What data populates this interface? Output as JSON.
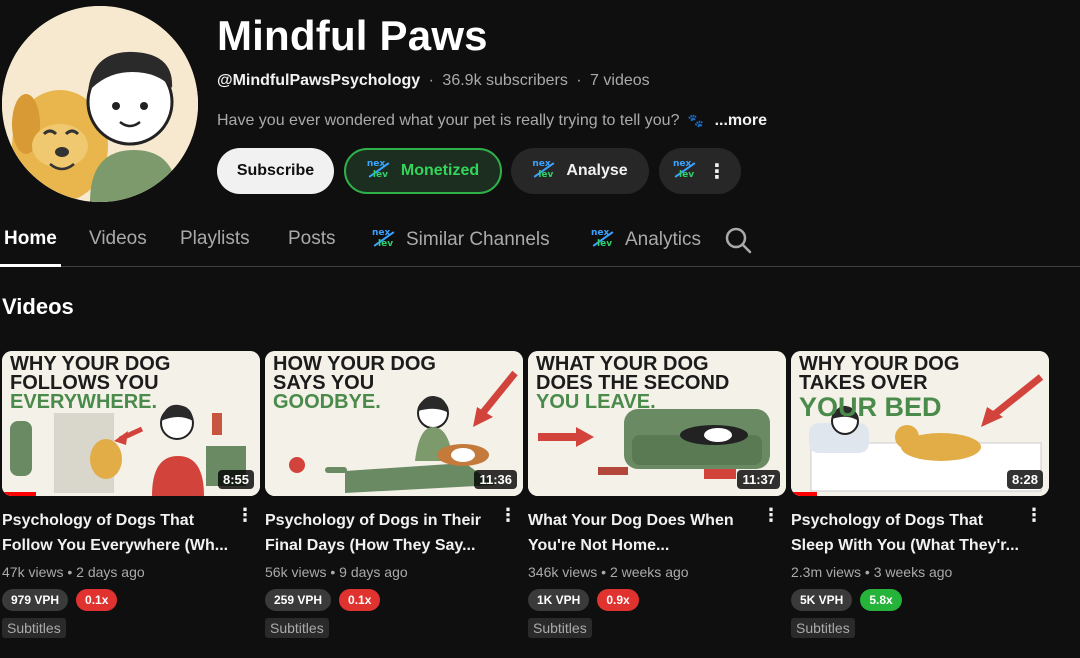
{
  "channel": {
    "name": "Mindful Paws",
    "handle": "@MindfulPawsPsychology",
    "subscribers": "36.9k subscribers",
    "video_count": "7 videos",
    "description": "Have you ever wondered what your pet is really trying to tell you?",
    "more_label": "...more",
    "separator": "·"
  },
  "buttons": {
    "subscribe": "Subscribe",
    "monetized": "Monetized",
    "analyse": "Analyse",
    "more_icon": "⋮"
  },
  "tabs": {
    "home": "Home",
    "videos": "Videos",
    "playlists": "Playlists",
    "posts": "Posts",
    "similar_channels": "Similar Channels",
    "analytics": "Analytics"
  },
  "section_title": "Videos",
  "videos": [
    {
      "thumb_lines": [
        "WHY YOUR DOG",
        "FOLLOWS YOU",
        "EVERYWHERE."
      ],
      "duration": "8:55",
      "title": "Psychology of Dogs That Follow You Everywhere (Wh...",
      "views": "47k views",
      "age": "2 days ago",
      "vph": "979 VPH",
      "ratio": "0.1x",
      "ratio_color": "red",
      "subtitles": "Subtitles",
      "progress": 0.13
    },
    {
      "thumb_lines": [
        "HOW YOUR DOG",
        "SAYS YOU",
        "GOODBYE."
      ],
      "duration": "11:36",
      "title": "Psychology of Dogs in Their Final Days (How They Say...",
      "views": "56k views",
      "age": "9 days ago",
      "vph": "259 VPH",
      "ratio": "0.1x",
      "ratio_color": "red",
      "subtitles": "Subtitles",
      "progress": 0
    },
    {
      "thumb_lines": [
        "WHAT YOUR DOG",
        "DOES THE SECOND",
        "YOU LEAVE."
      ],
      "duration": "11:37",
      "title": "What Your Dog Does When You're Not Home...",
      "views": "346k views",
      "age": "2 weeks ago",
      "vph": "1K VPH",
      "ratio": "0.9x",
      "ratio_color": "red",
      "subtitles": "Subtitles",
      "progress": 0
    },
    {
      "thumb_lines": [
        "WHY YOUR DOG",
        "TAKES OVER",
        "YOUR BED"
      ],
      "duration": "8:28",
      "title": "Psychology of Dogs That Sleep With You (What They'r...",
      "views": "2.3m views",
      "age": "3 weeks ago",
      "vph": "5K VPH",
      "ratio": "5.8x",
      "ratio_color": "green",
      "subtitles": "Subtitles",
      "progress": 0.1
    }
  ],
  "colors": {
    "background": "#0f0f0f",
    "monetized_green": "#35d45a",
    "ratio_red": "#e0322f",
    "ratio_green": "#25b33a",
    "progress_red": "#ff0000"
  },
  "icons": [
    "nexlev-logo-icon",
    "search-icon",
    "kebab-menu-icon",
    "paw-icon"
  ]
}
